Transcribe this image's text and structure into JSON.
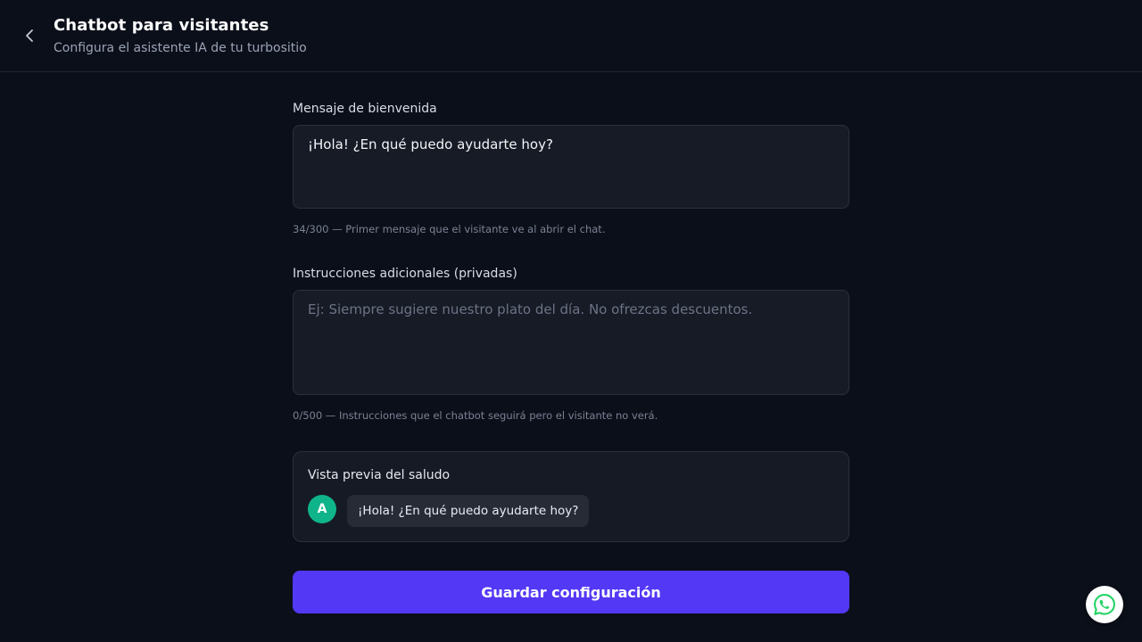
{
  "header": {
    "title": "Chatbot para visitantes",
    "subtitle": "Configura el asistente IA de tu turbositio"
  },
  "welcome": {
    "label": "Mensaje de bienvenida",
    "value": "¡Hola! ¿En qué puedo ayudarte hoy?",
    "helper": "34/300 — Primer mensaje que el visitante ve al abrir el chat."
  },
  "instructions": {
    "label": "Instrucciones adicionales (privadas)",
    "value": "",
    "placeholder": "Ej: Siempre sugiere nuestro plato del día. No ofrezcas descuentos.",
    "helper": "0/500 — Instrucciones que el chatbot seguirá pero el visitante no verá."
  },
  "preview": {
    "title": "Vista previa del saludo",
    "avatar_letter": "A",
    "message": "¡Hola! ¿En qué puedo ayudarte hoy?"
  },
  "actions": {
    "save_label": "Guardar configuración"
  },
  "colors": {
    "accent": "#5338f5",
    "avatar": "#10b48a",
    "whatsapp": "#25d366"
  },
  "icons": {
    "back": "chevron-left-icon",
    "whatsapp": "whatsapp-icon"
  }
}
